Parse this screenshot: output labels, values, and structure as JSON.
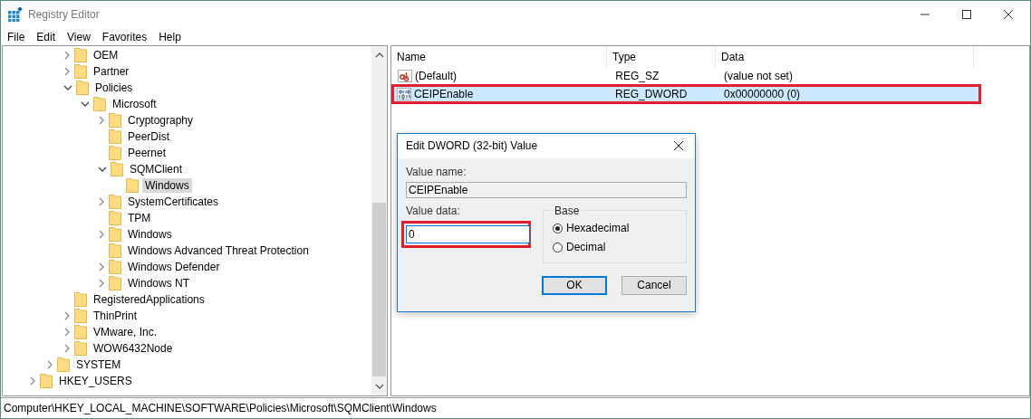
{
  "window": {
    "title": "Registry Editor"
  },
  "menu": [
    "File",
    "Edit",
    "View",
    "Favorites",
    "Help"
  ],
  "tree": [
    {
      "children": [
        {
          "children": [
            {
              "label": "OEM",
              "expandable": true,
              "expanded": false,
              "selected": false
            },
            {
              "label": "Partner",
              "expandable": true,
              "expanded": false,
              "selected": false
            },
            {
              "label": "Policies",
              "expandable": true,
              "expanded": true,
              "selected": false,
              "children": [
                {
                  "label": "Microsoft",
                  "expandable": true,
                  "expanded": true,
                  "selected": false,
                  "children": [
                    {
                      "label": "Cryptography",
                      "expandable": true,
                      "expanded": false,
                      "selected": false
                    },
                    {
                      "label": "PeerDist",
                      "expandable": false,
                      "selected": false
                    },
                    {
                      "label": "Peernet",
                      "expandable": false,
                      "selected": false
                    },
                    {
                      "label": "SQMClient",
                      "expandable": true,
                      "expanded": true,
                      "selected": false,
                      "children": [
                        {
                          "label": "Windows",
                          "expandable": false,
                          "selected": true
                        }
                      ]
                    },
                    {
                      "label": "SystemCertificates",
                      "expandable": true,
                      "expanded": false,
                      "selected": false
                    },
                    {
                      "label": "TPM",
                      "expandable": false,
                      "selected": false
                    },
                    {
                      "label": "Windows",
                      "expandable": true,
                      "expanded": false,
                      "selected": false
                    },
                    {
                      "label": "Windows Advanced Threat Protection",
                      "expandable": false,
                      "selected": false
                    },
                    {
                      "label": "Windows Defender",
                      "expandable": true,
                      "expanded": false,
                      "selected": false
                    },
                    {
                      "label": "Windows NT",
                      "expandable": true,
                      "expanded": false,
                      "selected": false
                    }
                  ]
                }
              ]
            },
            {
              "label": "RegisteredApplications",
              "expandable": false,
              "selected": false
            },
            {
              "label": "ThinPrint",
              "expandable": true,
              "expanded": false,
              "selected": false
            },
            {
              "label": "VMware, Inc.",
              "expandable": true,
              "expanded": false,
              "selected": false
            },
            {
              "label": "WOW6432Node",
              "expandable": true,
              "expanded": false,
              "selected": false
            }
          ]
        },
        {
          "label": "SYSTEM",
          "expandable": true,
          "expanded": false,
          "selected": false
        }
      ]
    },
    {
      "label": "HKEY_USERS",
      "expandable": true,
      "expanded": false,
      "selected": false
    }
  ],
  "values": {
    "columns": [
      "Name",
      "Type",
      "Data"
    ],
    "rows": [
      {
        "kind": "string",
        "name": "(Default)",
        "type": "REG_SZ",
        "data": "(value not set)",
        "selected": false,
        "highlighted": false
      },
      {
        "kind": "binary",
        "name": "CEIPEnable",
        "type": "REG_DWORD",
        "data": "0x00000000 (0)",
        "selected": true,
        "highlighted": true
      }
    ]
  },
  "dialog": {
    "title": "Edit DWORD (32-bit) Value",
    "value_name_label": "Value name:",
    "value_name": "CEIPEnable",
    "value_data_label": "Value data:",
    "value_data": "0",
    "value_data_highlighted": true,
    "base_label": "Base",
    "base_options": [
      {
        "label": "Hexadecimal",
        "selected": true
      },
      {
        "label": "Decimal",
        "selected": false
      }
    ],
    "buttons": [
      {
        "label": "OK",
        "default": true
      },
      {
        "label": "Cancel",
        "default": false
      }
    ]
  },
  "status_bar": "Computer\\HKEY_LOCAL_MACHINE\\SOFTWARE\\Policies\\Microsoft\\SQMClient\\Windows"
}
